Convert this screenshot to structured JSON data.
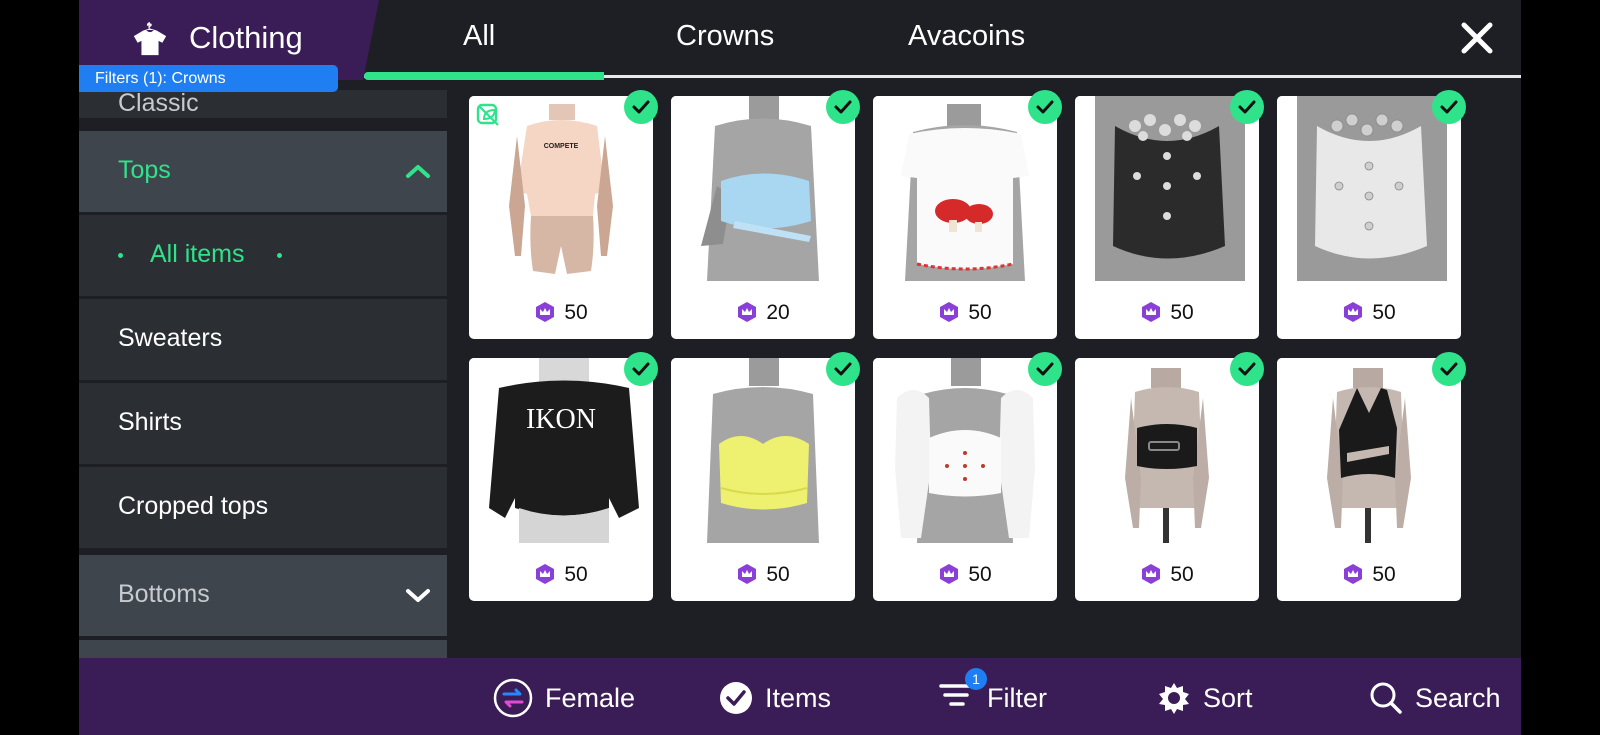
{
  "header": {
    "title": "Clothing",
    "filters_label": "Filters (1): Crowns",
    "tabs": [
      {
        "label": "All",
        "active": true
      },
      {
        "label": "Crowns",
        "active": false
      },
      {
        "label": "Avacoins",
        "active": false
      }
    ]
  },
  "sidebar": {
    "partial_top_label": "Classic",
    "items": [
      {
        "label": "Tops",
        "type": "category",
        "expanded": true
      },
      {
        "label": "All items",
        "type": "sub",
        "selected": true
      },
      {
        "label": "Sweaters",
        "type": "sub"
      },
      {
        "label": "Shirts",
        "type": "sub"
      },
      {
        "label": "Cropped tops",
        "type": "sub"
      },
      {
        "label": "Bottoms",
        "type": "category",
        "expanded": false
      }
    ]
  },
  "items": [
    {
      "price": "50",
      "owned": true,
      "eco": true,
      "desc": "t-shirt"
    },
    {
      "price": "20",
      "owned": true,
      "desc": "bandeau"
    },
    {
      "price": "50",
      "owned": true,
      "desc": "mushroom tee"
    },
    {
      "price": "50",
      "owned": true,
      "desc": "dark corset"
    },
    {
      "price": "50",
      "owned": true,
      "desc": "white corset"
    },
    {
      "price": "50",
      "owned": true,
      "desc": "IKON sweater"
    },
    {
      "price": "50",
      "owned": true,
      "desc": "yellow bustier"
    },
    {
      "price": "50",
      "owned": true,
      "desc": "puff sleeve top"
    },
    {
      "price": "50",
      "owned": true,
      "desc": "belted tube"
    },
    {
      "price": "50",
      "owned": true,
      "desc": "halter top"
    }
  ],
  "bottombar": {
    "gender_label": "Female",
    "items_label": "Items",
    "filter_label": "Filter",
    "filter_count": "1",
    "sort_label": "Sort",
    "search_label": "Search"
  },
  "colors": {
    "accent": "#2fe38b",
    "brand_purple": "#3a1d56",
    "filter_blue": "#1f7ff2",
    "crown_purple": "#8a3fd6"
  }
}
